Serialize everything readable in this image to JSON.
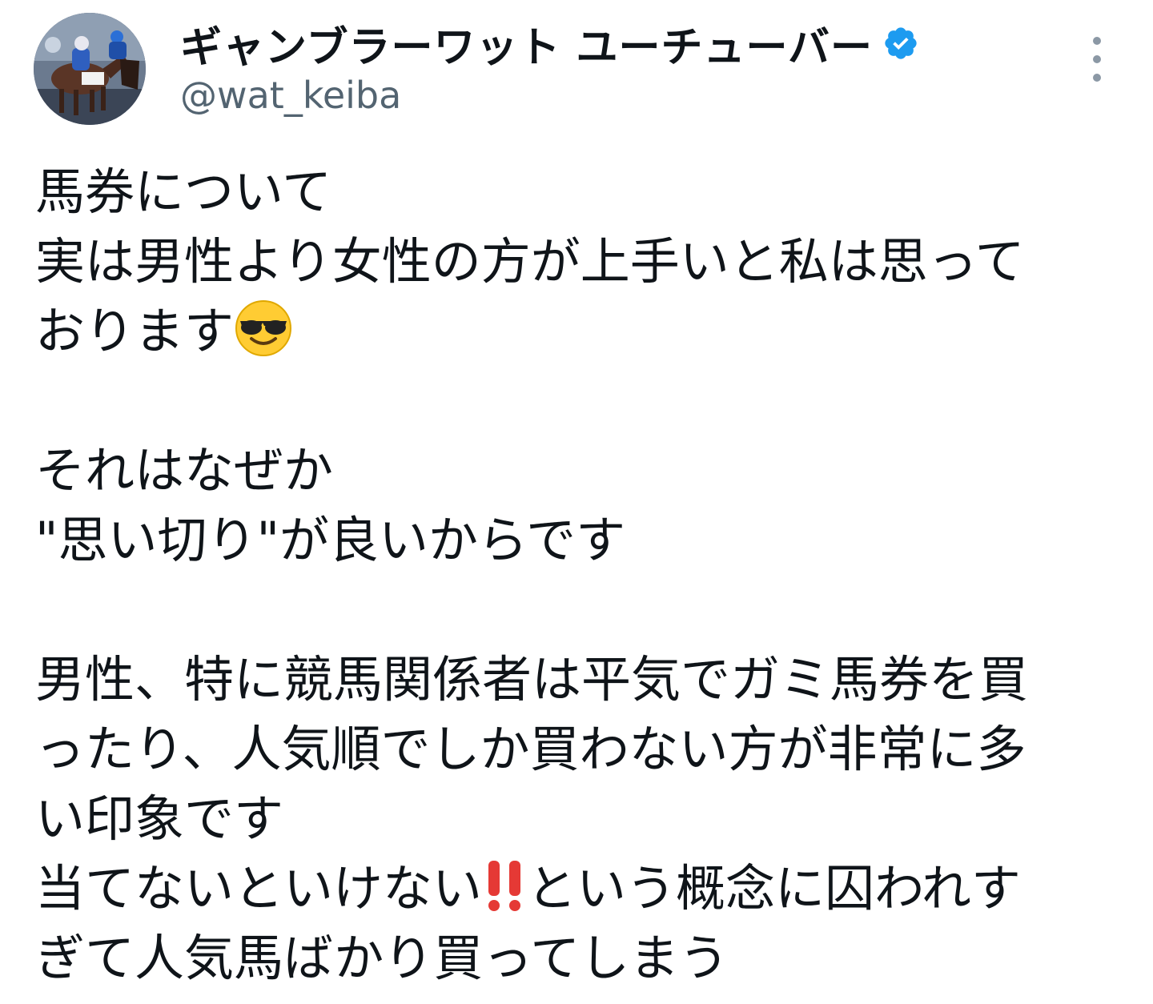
{
  "author": {
    "display_name": "ギャンブラーワット ユーチューバー",
    "handle": "@wat_keiba",
    "verified": true,
    "verified_color": "#1d9bf0"
  },
  "icons": {
    "avatar": "avatar-horse-race-photo",
    "verified": "verified-badge-icon",
    "more": "more-vertical-icon",
    "emoji_sunglasses": "smiling-face-with-sunglasses-emoji",
    "emoji_double_exclamation": "double-exclamation-mark-emoji"
  },
  "tweet": {
    "lines": [
      {
        "text": "馬券について"
      },
      {
        "text": "実は男性より女性の方が上手いと私は思って"
      },
      {
        "text": "おります",
        "emoji": "sunglasses"
      },
      {
        "text": ""
      },
      {
        "text": "それはなぜか"
      },
      {
        "text": "\"思い切り\"が良いからです"
      },
      {
        "text": ""
      },
      {
        "text": "男性、特に競馬関係者は平気でガミ馬券を買"
      },
      {
        "text": "ったり、人気順でしか買わない方が非常に多"
      },
      {
        "text": "い印象です"
      },
      {
        "text": "当てないといけない",
        "emoji": "double_exclamation",
        "after": "という概念に囚われす"
      },
      {
        "text": "ぎて人気馬ばかり買ってしまう"
      }
    ]
  }
}
